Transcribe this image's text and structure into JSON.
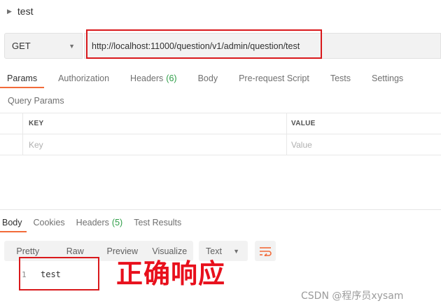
{
  "request": {
    "name": "test",
    "method": "GET",
    "url": "http://localhost:11000/question/v1/admin/question/test"
  },
  "request_tabs": [
    {
      "label": "Params",
      "count": ""
    },
    {
      "label": "Authorization",
      "count": ""
    },
    {
      "label": "Headers",
      "count": "(6)"
    },
    {
      "label": "Body",
      "count": ""
    },
    {
      "label": "Pre-request Script",
      "count": ""
    },
    {
      "label": "Tests",
      "count": ""
    },
    {
      "label": "Settings",
      "count": ""
    }
  ],
  "query_params": {
    "title": "Query Params",
    "key_header": "KEY",
    "value_header": "VALUE",
    "key_placeholder": "Key",
    "value_placeholder": "Value"
  },
  "response_tabs": [
    {
      "label": "Body",
      "count": ""
    },
    {
      "label": "Cookies",
      "count": ""
    },
    {
      "label": "Headers",
      "count": "(5)"
    },
    {
      "label": "Test Results",
      "count": ""
    }
  ],
  "format_buttons": [
    "Pretty",
    "Raw",
    "Preview",
    "Visualize"
  ],
  "response_language": "Text",
  "response_body": {
    "line_number": "1",
    "content": "test"
  },
  "annotation_text": "正确响应",
  "watermark": "CSDN @程序员xysam",
  "colors": {
    "accent_underline": "#f26b3a",
    "count_green": "#2e9e48",
    "highlight_red": "#d9191c",
    "annotation_red": "#e8101c"
  },
  "icons": {
    "expand_caret": "caret-right-icon",
    "dropdown": "chevron-down-icon",
    "wrap": "wrap-lines-icon"
  }
}
